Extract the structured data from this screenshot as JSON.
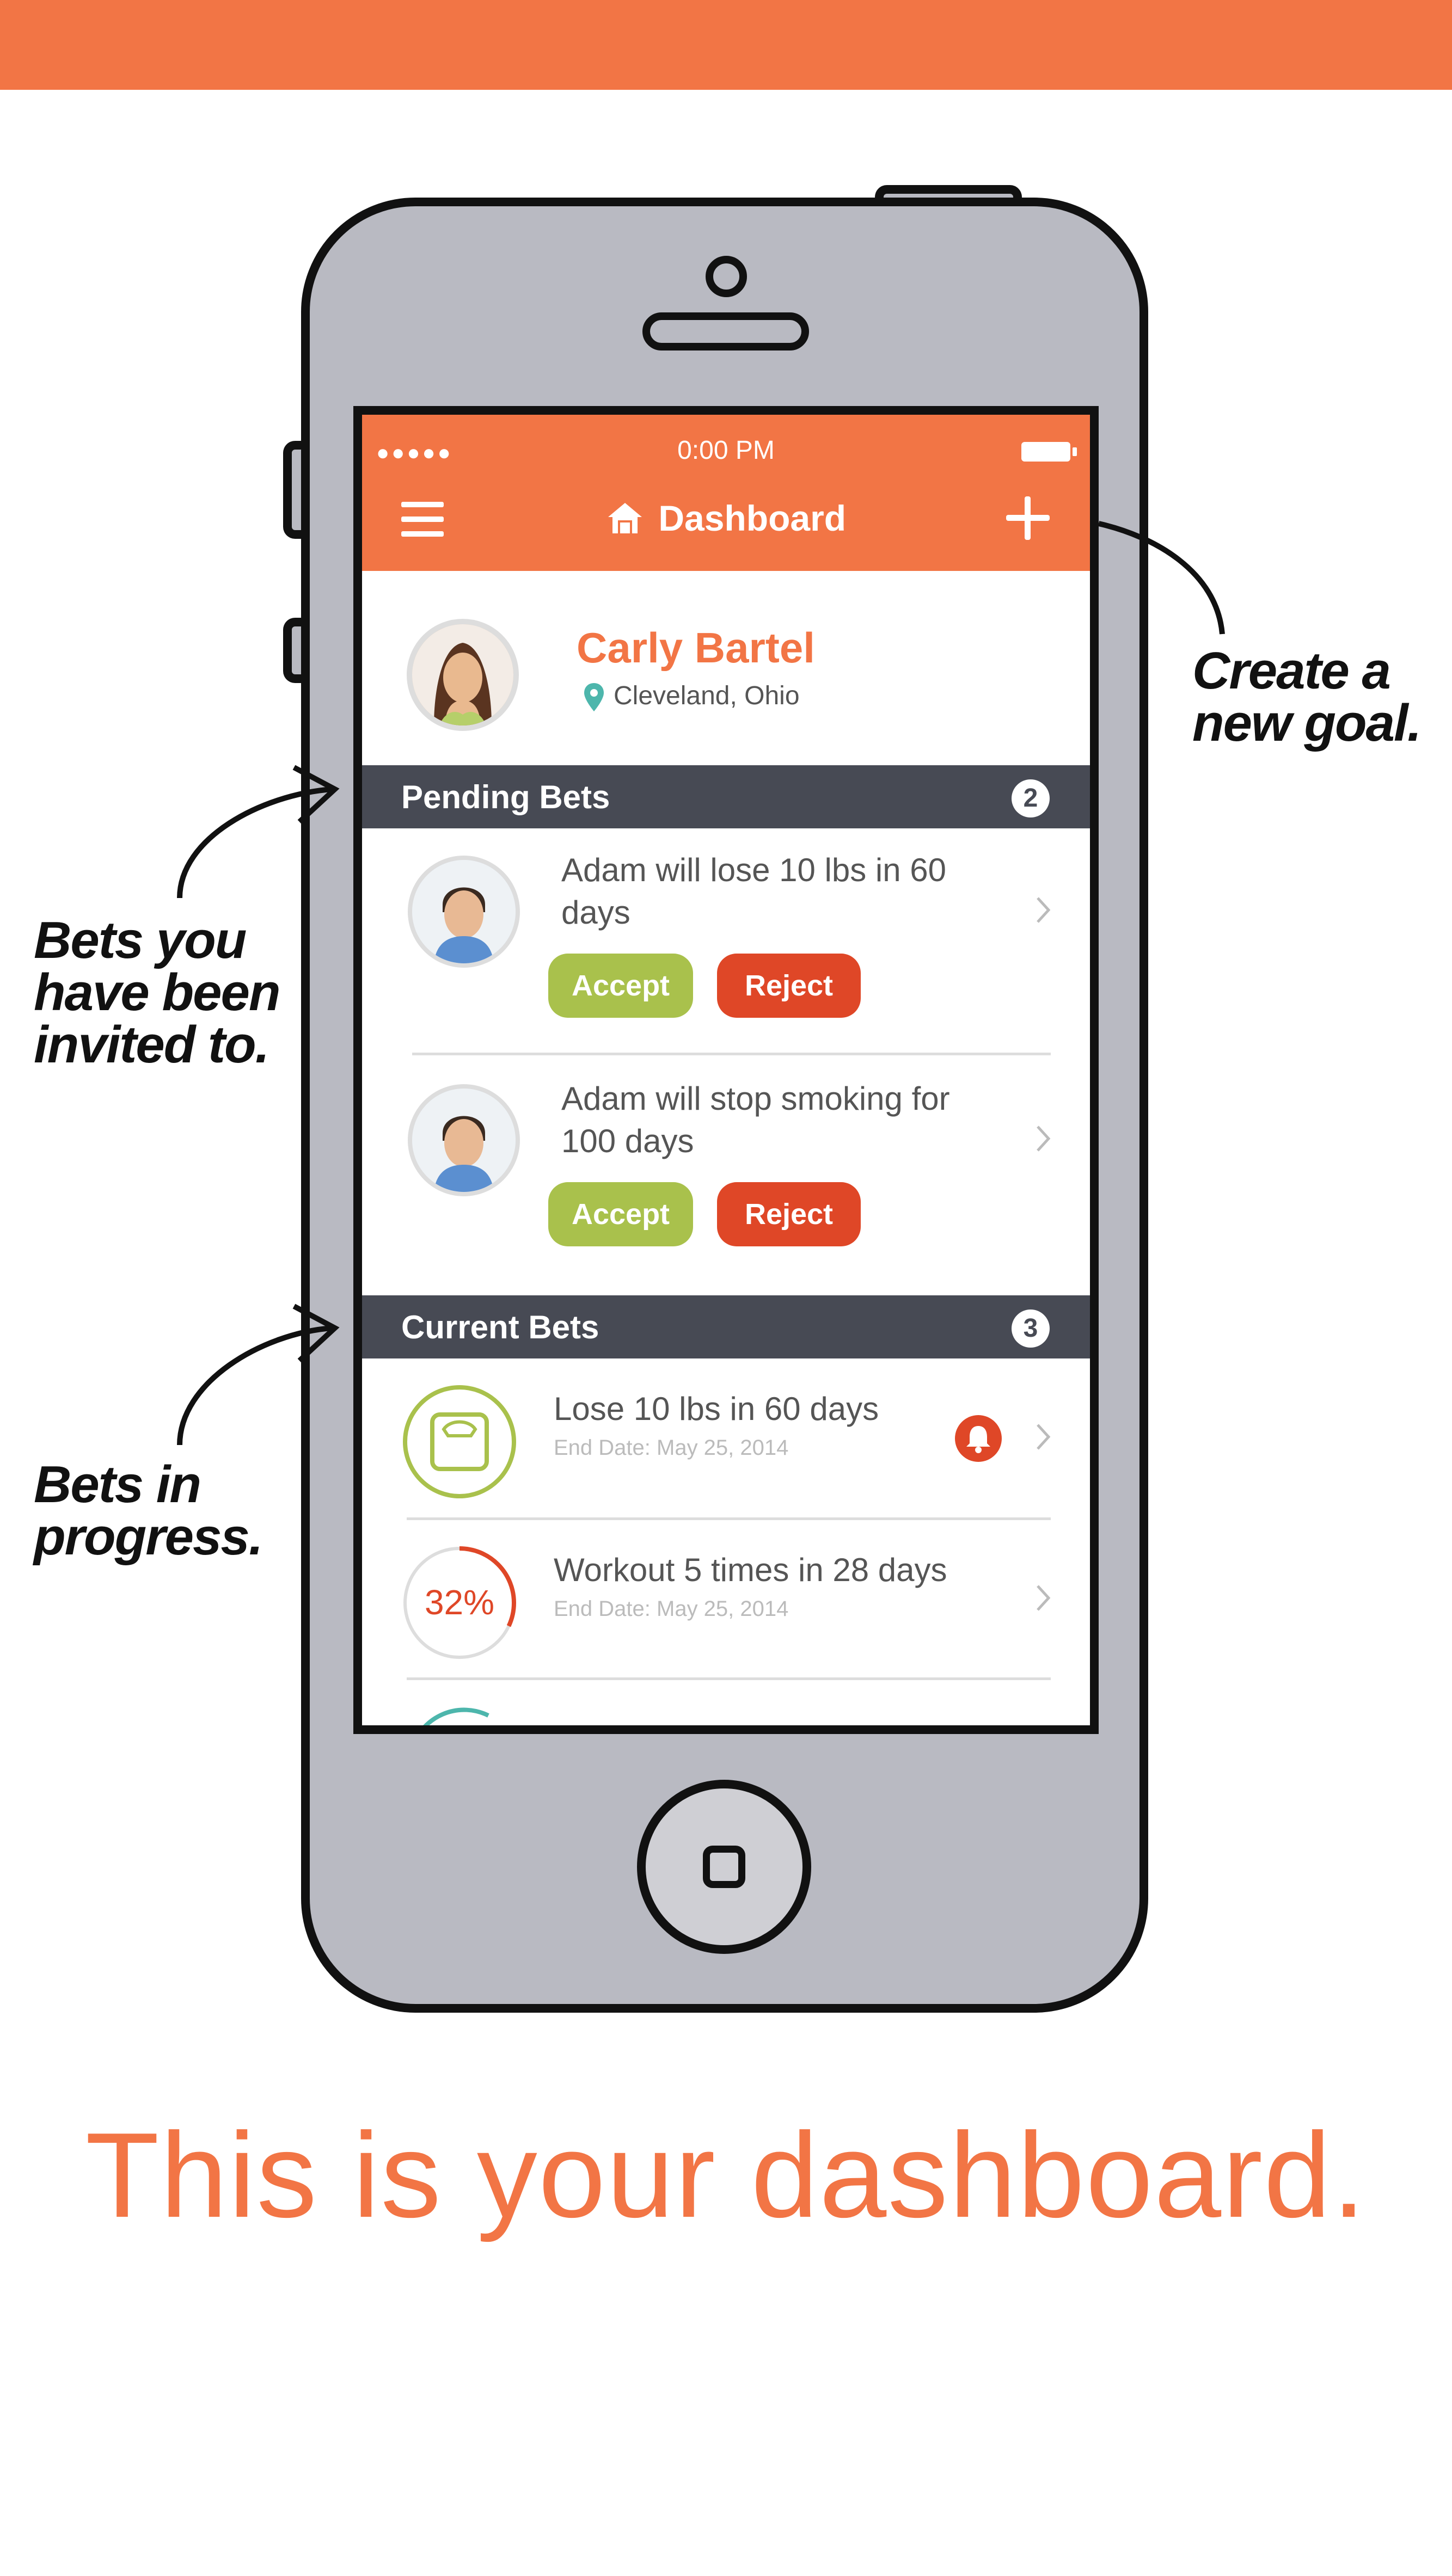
{
  "status_bar": {
    "time": "0:00 PM",
    "signal": "●●●●●"
  },
  "header": {
    "title": "Dashboard"
  },
  "profile": {
    "name": "Carly Bartel",
    "location": "Cleveland, Ohio"
  },
  "pending": {
    "title": "Pending Bets",
    "count": "2",
    "items": [
      {
        "text": "Adam will lose 10 lbs in 60 days",
        "accept": "Accept",
        "reject": "Reject"
      },
      {
        "text": "Adam will stop smoking for 100 days",
        "accept": "Accept",
        "reject": "Reject"
      }
    ]
  },
  "current": {
    "title": "Current Bets",
    "count": "3",
    "items": [
      {
        "title": "Lose 10 lbs in 60 days",
        "date": "End Date: May 25, 2014"
      },
      {
        "title": "Workout 5 times in 28 days",
        "date": "End Date: May 25, 2014",
        "progress_label": "32%",
        "progress": 0.32
      }
    ]
  },
  "annotations": {
    "create_goal": [
      "Create a",
      "new goal."
    ],
    "invited": [
      "Bets you",
      "have been",
      "invited to."
    ],
    "in_progress": [
      "Bets in",
      "progress."
    ]
  },
  "tagline": "This is your dashboard.",
  "colors": {
    "accent": "#F27545",
    "accept": "#A9C14C",
    "reject": "#DF4727",
    "section": "#474A54",
    "progress_ring": "#DF4727",
    "scale_ring": "#A9C14C",
    "partial_ring": "#4DB6AC"
  }
}
